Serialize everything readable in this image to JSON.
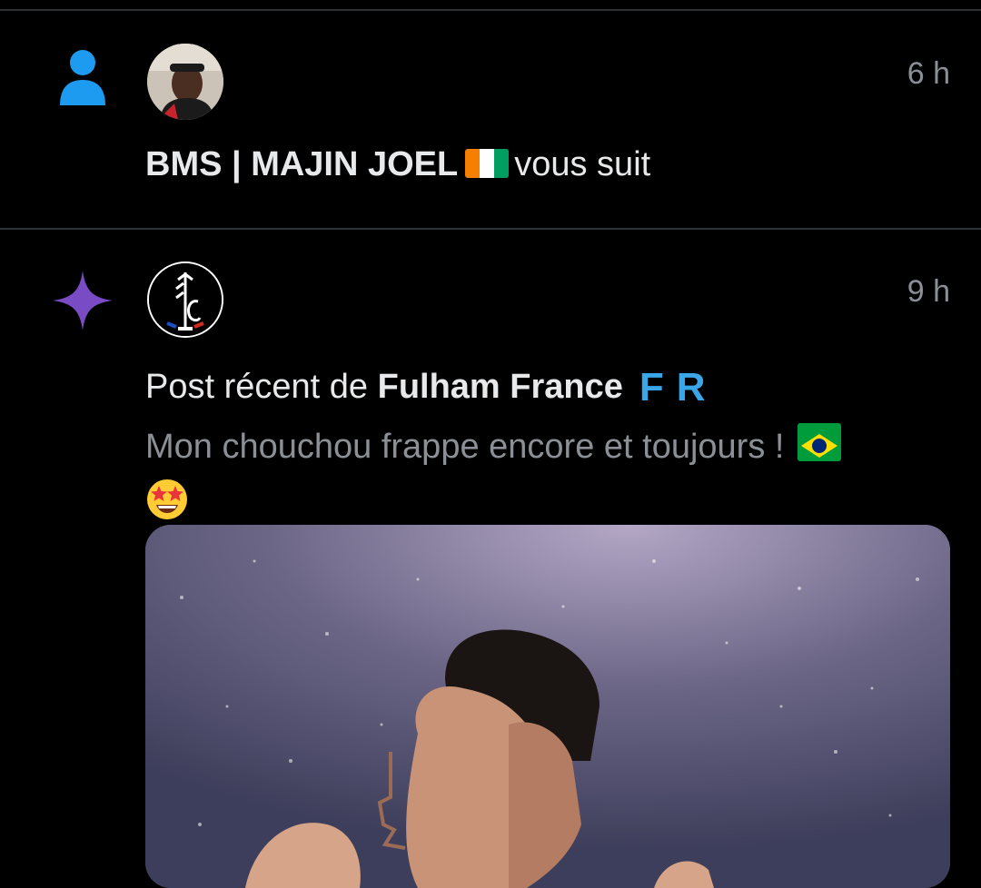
{
  "notifications": [
    {
      "type": "follow",
      "type_icon": "person-icon",
      "icon_color": "#1d9bf0",
      "timestamp": "6 h",
      "user_name": "BMS | MAJIN JOEL",
      "flag": "flag-cote-divoire",
      "action_text": "vous suit"
    },
    {
      "type": "recent-post",
      "type_icon": "sparkle-icon",
      "icon_color": "#794bc4",
      "timestamp": "9 h",
      "prefix_text": "Post récent de",
      "account_name": "Fulham France",
      "badge_text": "FR",
      "post_text": "Mon chouchou frappe encore et toujours !",
      "post_emojis": [
        "flag-brazil",
        "star-struck"
      ]
    }
  ],
  "colors": {
    "background": "#000000",
    "divider": "#2f3336",
    "text_primary": "#e7e9ea",
    "text_secondary": "#8b9096",
    "badge": "#3aa6e8"
  }
}
